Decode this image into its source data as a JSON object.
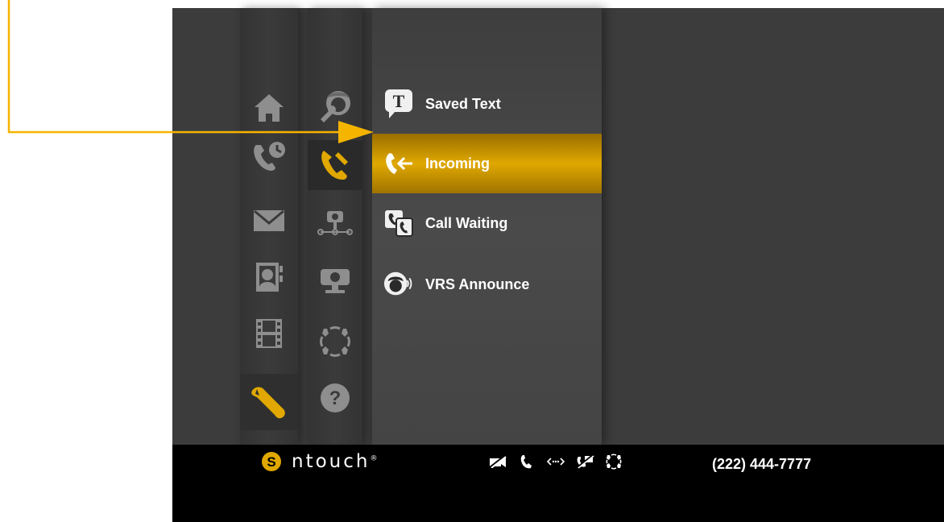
{
  "menu": {
    "items": [
      {
        "label": "Saved Text",
        "icon": "saved-text-icon"
      },
      {
        "label": "Incoming",
        "icon": "incoming-call-icon"
      },
      {
        "label": "Call Waiting",
        "icon": "call-waiting-icon"
      },
      {
        "label": "VRS Announce",
        "icon": "vrs-announce-icon"
      }
    ],
    "selected_index": 1
  },
  "main_nav": [
    "home-icon",
    "call-history-icon",
    "messages-icon",
    "contacts-icon",
    "video-center-icon",
    "settings-icon"
  ],
  "settings_nav": [
    "personal-settings-icon",
    "call-settings-icon",
    "network-settings-icon",
    "video-settings-icon",
    "ring-settings-icon",
    "help-icon"
  ],
  "bottom_bar": {
    "brand": "ntouch",
    "brand_mark": "®",
    "phone_number": "(222) 444-7777",
    "status_icons": [
      "video-privacy-icon",
      "phone-icon",
      "network-icon",
      "dnd-icon",
      "signal-icon"
    ]
  },
  "colors": {
    "accent": "#E0A800",
    "callout_line": "#F5B400",
    "background": "#3c3c3c"
  }
}
